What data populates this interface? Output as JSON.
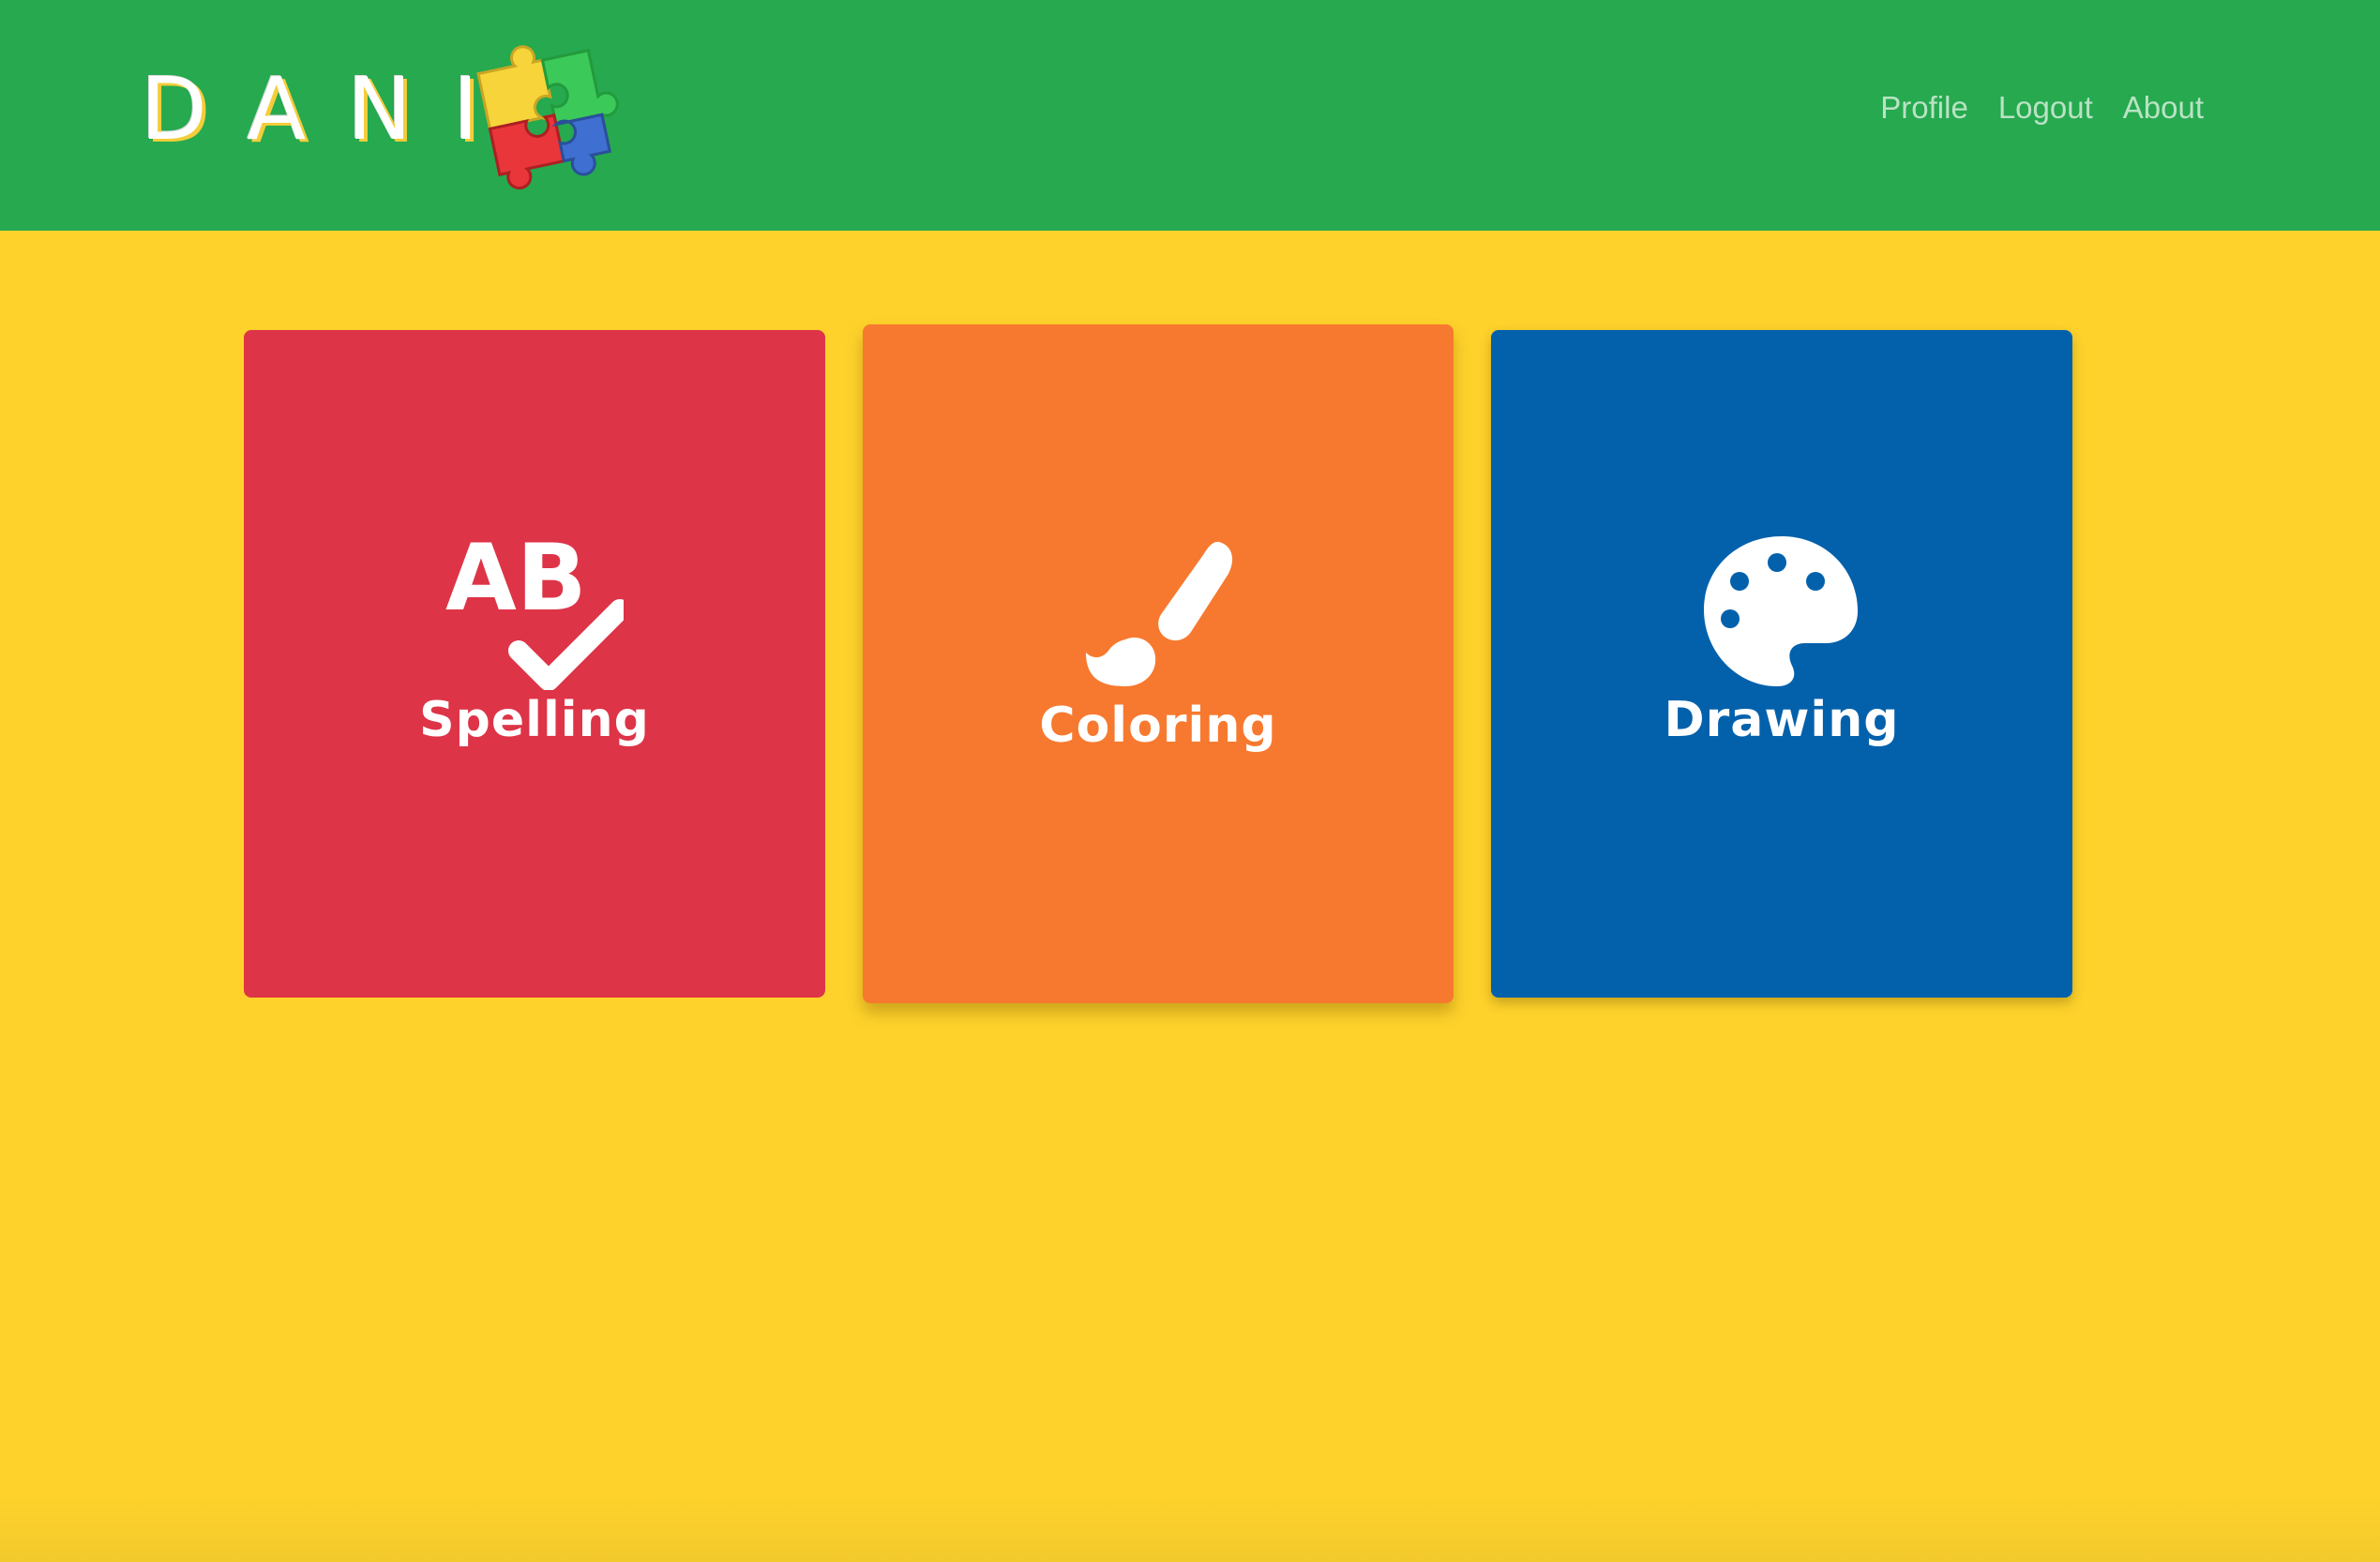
{
  "brand": {
    "name": "DANI"
  },
  "nav": {
    "items": [
      {
        "label": "Profile"
      },
      {
        "label": "Logout"
      },
      {
        "label": "About"
      }
    ]
  },
  "tiles": [
    {
      "label": "Spelling",
      "icon": "spelling-check-icon",
      "color": "#de3447"
    },
    {
      "label": "Coloring",
      "icon": "paintbrush-icon",
      "color": "#f7792f"
    },
    {
      "label": "Drawing",
      "icon": "palette-icon",
      "color": "#0361ac"
    }
  ],
  "colors": {
    "header": "#26a94f",
    "background": "#fed22b",
    "nav_text": "#b9e3c4"
  }
}
